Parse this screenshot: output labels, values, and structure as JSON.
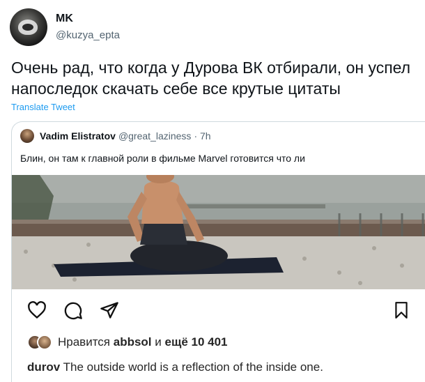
{
  "tweet": {
    "display_name": "MK",
    "handle": "@kuzya_epta",
    "text": "Очень рад, что когда у Дурова ВК отбирали, он успел напоследок скачать себе все крутые цитаты",
    "translate_label": "Translate Tweet"
  },
  "quote": {
    "name": "Vadim Elistratov",
    "handle": "@great_laziness",
    "time": "· 7h",
    "text": "Блин, он там к главной роли в фильме Marvel готовится что ли"
  },
  "instagram": {
    "actions": [
      "heart-icon",
      "comment-icon",
      "share-icon",
      "bookmark-icon"
    ],
    "likes_prefix": "Нравится",
    "likes_user": "abbsol",
    "likes_middle": "и",
    "likes_count": "ещё 10 401",
    "caption_user": "durov",
    "caption_text": "The outside world is a reflection of the inside one."
  }
}
